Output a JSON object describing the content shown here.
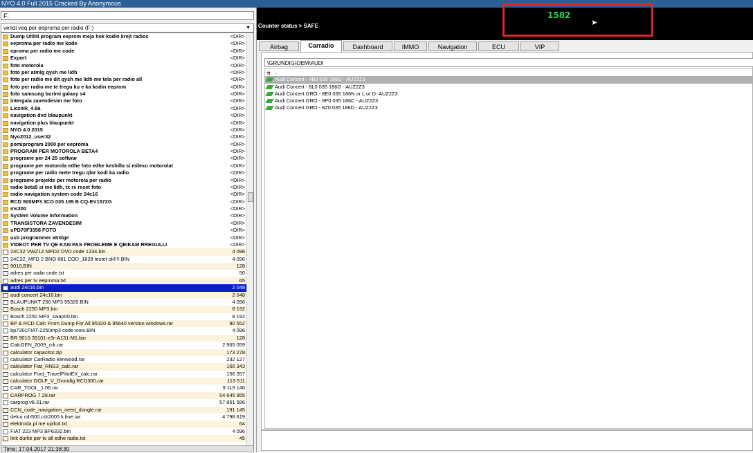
{
  "window": {
    "title": "NYO 4.0 Full 2015 Cracked By Anonymous"
  },
  "left": {
    "drive": "F:",
    "folder": "vendi veq per eeproma per radio (F:)",
    "status": "Time: 17.04.2017 21:38:30",
    "rows": [
      {
        "name": "Dump Utiliti program eeprom meja hek kodin krejt radios",
        "size": "<DIR>",
        "type": "dir"
      },
      {
        "name": "eeproma per radio me kode",
        "size": "<DIR>",
        "type": "dir"
      },
      {
        "name": "eproma per radio me code",
        "size": "<DIR>",
        "type": "dir"
      },
      {
        "name": "Export",
        "size": "<DIR>",
        "type": "dir"
      },
      {
        "name": "foto motorola",
        "size": "<DIR>",
        "type": "dir"
      },
      {
        "name": "foto per atmlg qysh me lidh",
        "size": "<DIR>",
        "type": "dir"
      },
      {
        "name": "foto per radio me dit qysh me lidh me tela  per radio all",
        "size": "<DIR>",
        "type": "dir"
      },
      {
        "name": "foto per radio me te tregu ku e ka kodin eeprom",
        "size": "<DIR>",
        "type": "dir"
      },
      {
        "name": "foto samsung burimi galaxy s4",
        "size": "<DIR>",
        "type": "dir"
      },
      {
        "name": "intergala zavendesim me foto",
        "size": "<DIR>",
        "type": "dir"
      },
      {
        "name": "Licznik_4.8a",
        "size": "<DIR>",
        "type": "dir"
      },
      {
        "name": "navigation dvd blaupunkt",
        "size": "<DIR>",
        "type": "dir"
      },
      {
        "name": "navigation plus blaupunkt",
        "size": "<DIR>",
        "type": "dir"
      },
      {
        "name": "NYO 4.0 2015",
        "size": "<DIR>",
        "type": "dir"
      },
      {
        "name": "Nyo2012_user32",
        "size": "<DIR>",
        "type": "dir"
      },
      {
        "name": "pomiprogram 2000 per eeproma",
        "size": "<DIR>",
        "type": "dir"
      },
      {
        "name": "PROGRAM PER MOTOROLA BETA4",
        "size": "<DIR>",
        "type": "dir"
      },
      {
        "name": "programe per 24 25 softwar",
        "size": "<DIR>",
        "type": "dir"
      },
      {
        "name": "programe per motorola edhe foto  edhe keshilla si milexu motorolat",
        "size": "<DIR>",
        "type": "dir"
      },
      {
        "name": "programe per radio mete tregu qfar kodi ka radio",
        "size": "<DIR>",
        "type": "dir"
      },
      {
        "name": "programe projekte per motorola per radio",
        "size": "<DIR>",
        "type": "dir"
      },
      {
        "name": "radio beta5 si me lidh, tx rx reset foto",
        "size": "<DIR>",
        "type": "dir"
      },
      {
        "name": "radio navigation system code 24c16",
        "size": "<DIR>",
        "type": "dir"
      },
      {
        "name": "RCD 500MP3 3CO 035 195 B CQ-EV1572G",
        "size": "<DIR>",
        "type": "dir"
      },
      {
        "name": "ms300",
        "size": "<DIR>",
        "type": "dir"
      },
      {
        "name": "System Volume Information",
        "size": "<DIR>",
        "type": "dir"
      },
      {
        "name": "TRANSISTORA ZAVENDESIM",
        "size": "<DIR>",
        "type": "dir"
      },
      {
        "name": "uPD70F3358 FOTO",
        "size": "<DIR>",
        "type": "dir"
      },
      {
        "name": "usb programmer atmlge",
        "size": "<DIR>",
        "type": "dir"
      },
      {
        "name": "VIDEOT PER TV QE KAN PAS PROBLEME E QEIKAM RREGULLI",
        "size": "<DIR>",
        "type": "dir"
      },
      {
        "name": "24C32 VWZ1Z MFD2 DVD code 1234.bin",
        "size": "4 096",
        "type": "file"
      },
      {
        "name": "24C32_MFD 2 BNO 881 COD_1828 testet ok!!!!.BIN",
        "size": "4 096",
        "type": "file"
      },
      {
        "name": "9010.BIN",
        "size": "128",
        "type": "file"
      },
      {
        "name": "adres per radio code.txt",
        "size": "50",
        "type": "file"
      },
      {
        "name": "adres per tv eeproma.txt",
        "size": "65",
        "type": "file"
      },
      {
        "name": "audi 24c16.bin",
        "size": "2 048",
        "type": "file"
      },
      {
        "name": "audi concert 24c16.bin",
        "size": "2 048",
        "type": "file"
      },
      {
        "name": "BLAUPUNKT 250 MP3 95320.BIN",
        "size": "4 096",
        "type": "file"
      },
      {
        "name": "Bosch 2250 MP3.bin",
        "size": "8 192",
        "type": "file"
      },
      {
        "name": "Bosch 2250 MP3_swap00.bin",
        "size": "8 192",
        "type": "file"
      },
      {
        "name": "BP & RCD Calc From Dump For All 95320 & 95640 version windows.rar",
        "size": "90 552",
        "type": "file"
      },
      {
        "name": "bp7301FIAT-2250mp3 code xxxx.BIN",
        "size": "4 096",
        "type": "file"
      },
      {
        "name": "BR 9010 39101-e3r-A131-M1.bin",
        "size": "128",
        "type": "file"
      },
      {
        "name": "CalcGEN_2009_crk.rar",
        "size": "2 965 059",
        "type": "file"
      },
      {
        "name": "calculator capacitor.zip",
        "size": "173 278",
        "type": "file"
      },
      {
        "name": "calculator CarRadio kenwood.rar",
        "size": "232 127",
        "type": "file"
      },
      {
        "name": "calculator Fiat_RNS3_calc.rar",
        "size": "156 343",
        "type": "file"
      },
      {
        "name": "calculator Ford_TravelPilotEX_calc.rar",
        "size": "156 357",
        "type": "file"
      },
      {
        "name": "calculator GOLF_V_Grundig RCD300.rar",
        "size": "113 511",
        "type": "file"
      },
      {
        "name": "CAR_TOOL_1.06.rar",
        "size": "9 119 146",
        "type": "file"
      },
      {
        "name": "CARPROG 7.28.rar",
        "size": "54 645 955",
        "type": "file"
      },
      {
        "name": "carprog v8.31.rar",
        "size": "57 851 586",
        "type": "file"
      },
      {
        "name": "CCN_code_navigation_need_dongle.rar",
        "size": "191 145",
        "type": "file"
      },
      {
        "name": "delco cdr500.cdr2005 k line.rar",
        "size": "4 798 619",
        "type": "file"
      },
      {
        "name": "elektroda.pl  me upllod.txt",
        "size": "64",
        "type": "file"
      },
      {
        "name": "FIAT 223 MP3 BP6332.bin",
        "size": "4 096",
        "type": "file"
      },
      {
        "name": "link durke per tv all edhe radio.txt",
        "size": "45",
        "type": "file"
      }
    ]
  },
  "right": {
    "counter_status": "Counter status > SAFE",
    "pin": "1582",
    "tabs": [
      "Airbag",
      "Carradio",
      "Dashboard",
      "IMMO",
      "Navigation",
      "ECU",
      "VIP"
    ],
    "active_tab": "Carradio",
    "path": "\\GRUNDIG\\OEM\\AUDI",
    "up": "..",
    "results": [
      "Audi Concert - 4B0 035 186G - AUZ2Z3",
      "Audi Concert - 8L0 035 186G - AUZ2Z3",
      "Audi Concert GRO - 8E0 035 186N or L or D- AUZ2Z3",
      "Audi Concert GRO - 8P0 035 186C - AUZ2Z3",
      "Audi Concert GRO - 8Z0 035 186D - AUZ2Z3"
    ]
  }
}
